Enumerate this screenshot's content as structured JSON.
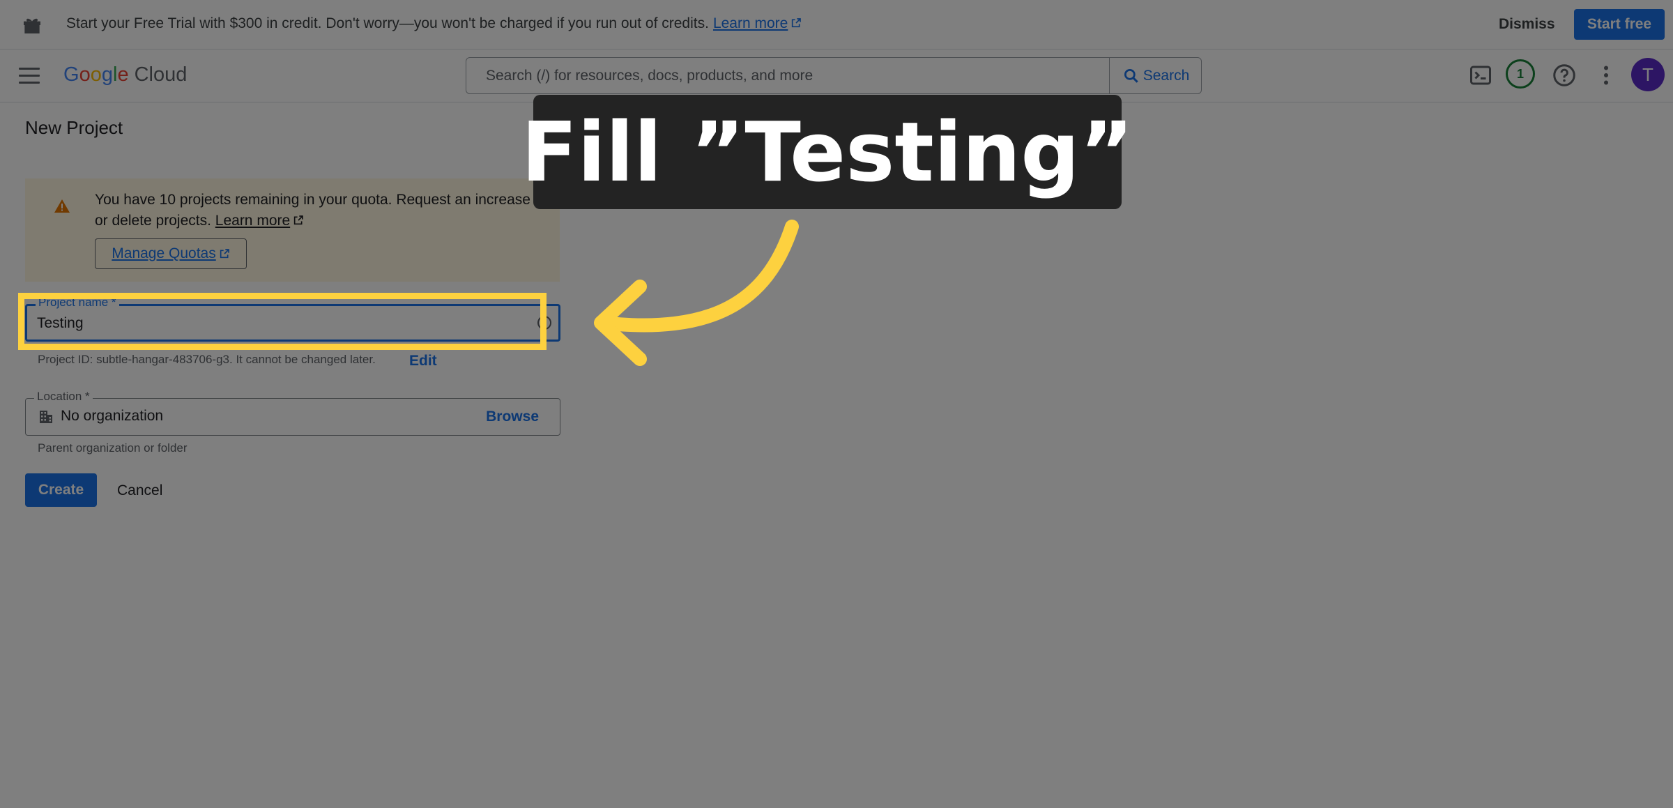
{
  "promo": {
    "text": "Start your Free Trial with $300 in credit. Don't worry—you won't be charged if you run out of credits.",
    "learn_more": "Learn more",
    "dismiss": "Dismiss",
    "start_free": "Start free"
  },
  "header": {
    "logo_letters": [
      "G",
      "o",
      "o",
      "g",
      "l",
      "e"
    ],
    "logo_product": "Cloud",
    "search_placeholder": "Search (/) for resources, docs, products, and more",
    "search_button": "Search",
    "notification_count": "1",
    "avatar_initial": "T"
  },
  "page": {
    "title": "New Project",
    "warning": {
      "text": "You have 10 projects remaining in your quota. Request an increase or delete projects.",
      "learn_more": "Learn more",
      "manage_quotas": "Manage Quotas"
    },
    "project_name": {
      "label": "Project name *",
      "value": "Testing",
      "helper": "Project ID: subtle-hangar-483706-g3. It cannot be changed later.",
      "edit": "Edit"
    },
    "location": {
      "label": "Location *",
      "value": "No organization",
      "browse": "Browse",
      "helper": "Parent organization or folder"
    },
    "create": "Create",
    "cancel": "Cancel"
  },
  "overlay": {
    "callout": "Fill ”Testing”",
    "highlight_color": "#fdd13f",
    "dim_color": "rgba(0,0,0,0.5)"
  },
  "colors": {
    "accent": "#1a73e8",
    "warning_bg": "#fef7e0",
    "avatar": "#5b2ac8",
    "notification": "#188038"
  }
}
